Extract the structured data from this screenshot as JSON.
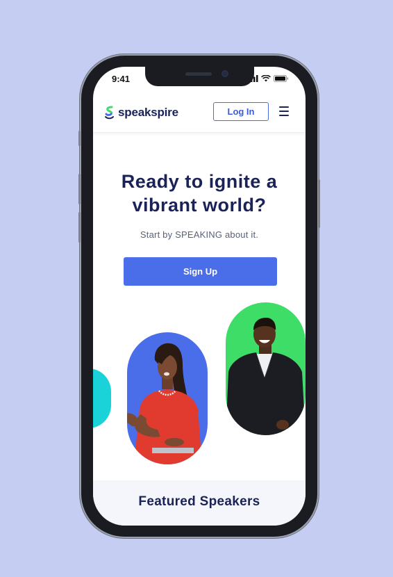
{
  "status_bar": {
    "time": "9:41",
    "icons": [
      "signal-icon",
      "wifi-icon",
      "battery-icon"
    ]
  },
  "header": {
    "brand_name": "speakspire",
    "login_label": "Log In",
    "menu_icon": "hamburger-menu-icon"
  },
  "hero": {
    "title_line1": "Ready to ignite a",
    "title_line2": "vibrant world?",
    "subtitle": "Start by SPEAKING about it.",
    "signup_label": "Sign Up"
  },
  "speaker_cards": [
    {
      "color": "#19d3d8"
    },
    {
      "color": "#4a6ee9"
    },
    {
      "color": "#3edd68"
    }
  ],
  "featured": {
    "title": "Featured Speakers"
  },
  "colors": {
    "background": "#c5cdf3",
    "brand_navy": "#1a2258",
    "accent_blue": "#4a6ee9",
    "accent_green": "#3edd68",
    "accent_teal": "#19d3d8"
  }
}
